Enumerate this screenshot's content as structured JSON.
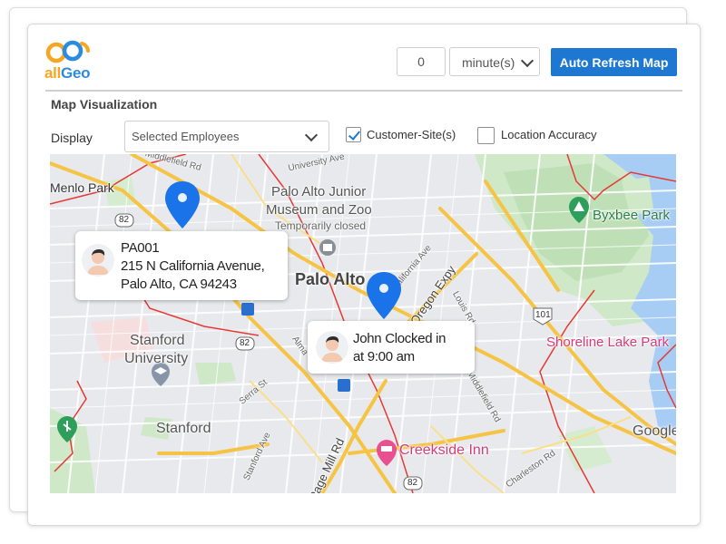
{
  "brand": {
    "logo_part1": "all",
    "logo_part2": "Geo",
    "colors": {
      "orange": "#f5a623",
      "blue": "#2a8be0"
    }
  },
  "toolbar": {
    "refresh_interval_value": "0",
    "unit_selected": "minute(s)",
    "auto_refresh_label": "Auto Refresh Map",
    "accent_color": "#1e78d2"
  },
  "section": {
    "title": "Map Visualization"
  },
  "filters": {
    "display_label": "Display",
    "display_selected": "Selected Employees",
    "customer_sites": {
      "label": "Customer-Site(s)",
      "checked": true
    },
    "location_accuracy": {
      "label": "Location Accuracy",
      "checked": false
    }
  },
  "map": {
    "places": {
      "menlo_park": "Menlo Park",
      "museum_l1": "Palo Alto Junior",
      "museum_l2": "Museum and Zoo",
      "museum_status": "Temporarily closed",
      "palo_alto": "Palo Alto",
      "stanford_univ_l1": "Stanford",
      "stanford_univ_l2": "University",
      "stanford": "Stanford",
      "byxbee": "Byxbee Park",
      "shoreline": "Shoreline Lake Park",
      "creekside": "Creekside Inn",
      "google": "Google"
    },
    "roads": {
      "r82_a": "82",
      "r82_b": "82",
      "r82_c": "82",
      "r101": "101",
      "university_ave": "University Ave",
      "california_ave": "California Ave",
      "oregon_expy": "Oregon Expy",
      "louis_rd": "Louis Rd",
      "middlefield_rd": "Middlefield Rd",
      "page_mill_rd": "Page Mill Rd",
      "serra_st": "Serra St",
      "stanford_ave": "Stanford Ave",
      "charleston_rd": "Charleston Rd",
      "almanor": "Alma",
      "top_rd": "Middlefield Rd"
    },
    "pins": [
      {
        "id": "PA001",
        "line1": "PA001",
        "line2": "215 N California Avenue,",
        "line3": "Palo Alto, CA 94243"
      },
      {
        "id": "john",
        "line1": "John Clocked in",
        "line2": "at 9:00 am"
      }
    ],
    "colors": {
      "pin": "#1a73e8",
      "road": "#f6c445",
      "water": "#a3c8f2",
      "park": "#c9e6c5",
      "boundary": "#e53935"
    }
  }
}
